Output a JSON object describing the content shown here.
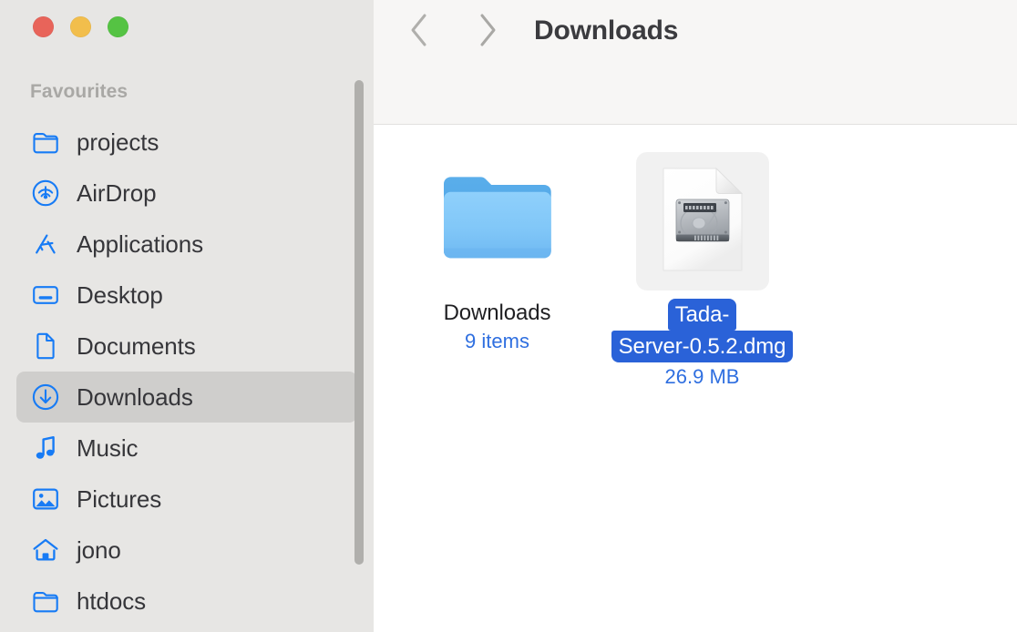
{
  "window": {
    "title": "Downloads",
    "traffic_lights": [
      {
        "name": "close",
        "color": "#e8645a"
      },
      {
        "name": "minimize",
        "color": "#f2be4c"
      },
      {
        "name": "maximize",
        "color": "#55c343"
      }
    ]
  },
  "toolbar": {
    "back_icon": "chevron-left-icon",
    "forward_icon": "chevron-right-icon",
    "title": "Downloads"
  },
  "sidebar": {
    "section_label": "Favourites",
    "selected_index": 5,
    "items": [
      {
        "label": "projects",
        "icon": "folder-icon"
      },
      {
        "label": "AirDrop",
        "icon": "airdrop-icon"
      },
      {
        "label": "Applications",
        "icon": "applications-icon"
      },
      {
        "label": "Desktop",
        "icon": "desktop-icon"
      },
      {
        "label": "Documents",
        "icon": "document-icon"
      },
      {
        "label": "Downloads",
        "icon": "downloads-icon"
      },
      {
        "label": "Music",
        "icon": "music-note-icon"
      },
      {
        "label": "Pictures",
        "icon": "pictures-icon"
      },
      {
        "label": "jono",
        "icon": "home-icon"
      },
      {
        "label": "htdocs",
        "icon": "folder-icon"
      }
    ],
    "scrollbar": {
      "name": "sidebar-scrollbar"
    }
  },
  "files": [
    {
      "name": "Downloads",
      "name_lines": [
        "Downloads"
      ],
      "meta": "9 items",
      "icon": "blue-folder-icon",
      "selected": false
    },
    {
      "name": "Tada-Server-0.5.2.dmg",
      "name_lines": [
        "Tada-",
        "Server-0.5.2.dmg"
      ],
      "meta": "26.9 MB",
      "icon": "disk-image-document-icon",
      "selected": true
    }
  ],
  "colors": {
    "accent": "#2f6fe0",
    "selection": "#2a62d8",
    "sidebar_icon": "#177bf5",
    "sidebar_bg": "#e7e6e4",
    "toolbar_bg": "#f7f6f5"
  }
}
